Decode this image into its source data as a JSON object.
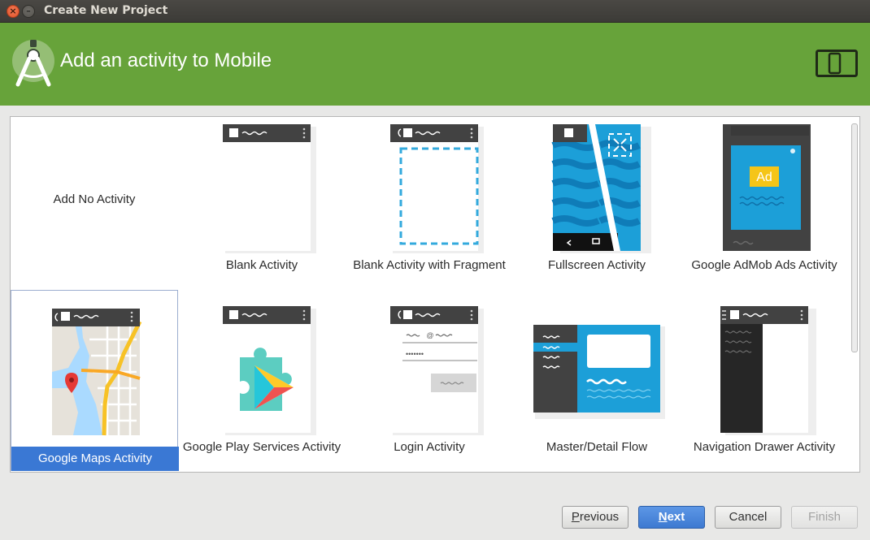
{
  "window": {
    "title": "Create New Project"
  },
  "header": {
    "title": "Add an activity to Mobile",
    "logo_icon": "android-studio-icon",
    "device_icon": "phone-tablet-icon",
    "color": "#67a33a"
  },
  "gallery": {
    "selected": "Google Maps Activity",
    "tiles": [
      {
        "label": "Add No Activity"
      },
      {
        "label": "Blank Activity"
      },
      {
        "label": "Blank Activity with Fragment"
      },
      {
        "label": "Fullscreen Activity"
      },
      {
        "label": "Google AdMob Ads Activity",
        "badge": "Ad"
      },
      {
        "label": "Google Maps Activity"
      },
      {
        "label": "Google Play Services Activity"
      },
      {
        "label": "Login Activity",
        "email_placeholder": "@",
        "password_mask": "•••••••"
      },
      {
        "label": "Master/Detail Flow"
      },
      {
        "label": "Navigation Drawer Activity"
      }
    ]
  },
  "buttons": {
    "previous_first": "P",
    "previous_rest": "revious",
    "next_first": "N",
    "next_rest": "ext",
    "cancel": "Cancel",
    "finish": "Finish"
  },
  "colors": {
    "accent": "#3a78d4",
    "primary_button": "#4a86da"
  }
}
